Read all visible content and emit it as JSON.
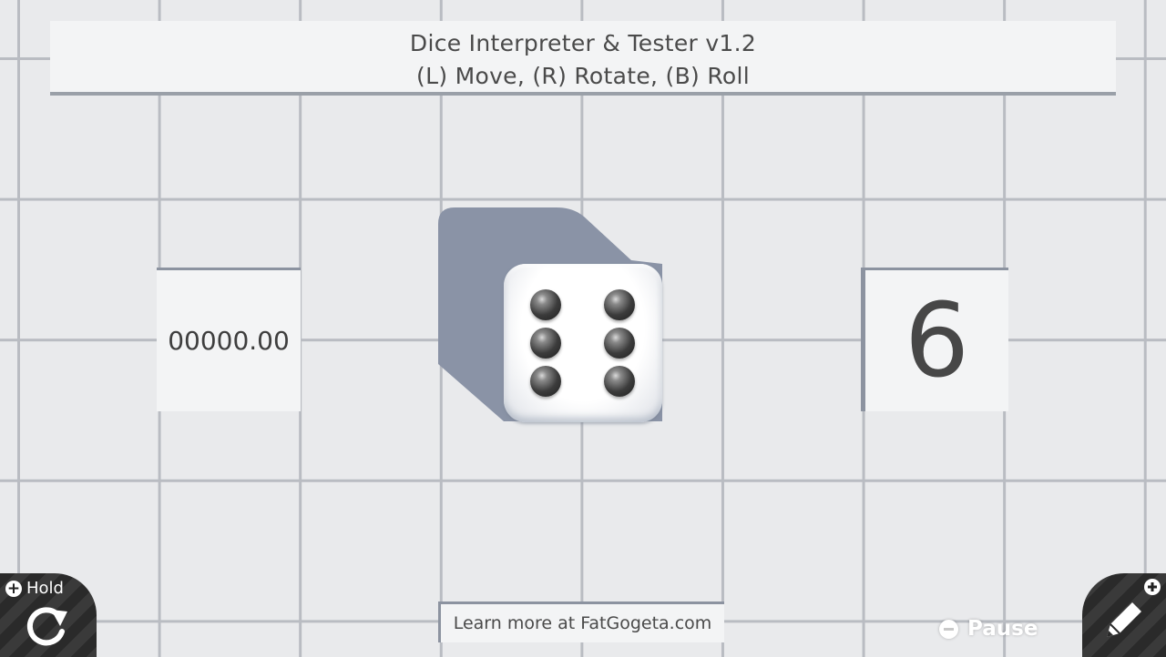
{
  "banner": {
    "title": "Dice Interpreter & Tester v1.2",
    "instructions": "(L) Move, (R) Rotate, (B) Roll"
  },
  "timer": {
    "value": "00000.00"
  },
  "die": {
    "face": 6,
    "pip_color": "#2b2b2b"
  },
  "result": {
    "value": "6"
  },
  "footer": {
    "link_text": "Learn more at FatGogeta.com"
  },
  "controls": {
    "hold_label": "Hold",
    "pause_label": "Pause",
    "icons": [
      "plus-icon",
      "rotate-icon",
      "minus-icon",
      "pencil-icon"
    ]
  },
  "colors": {
    "background": "#e9eaec",
    "grid": "#b9bcc2",
    "panel": "#f3f4f5",
    "shadow": "#8a93a6"
  }
}
